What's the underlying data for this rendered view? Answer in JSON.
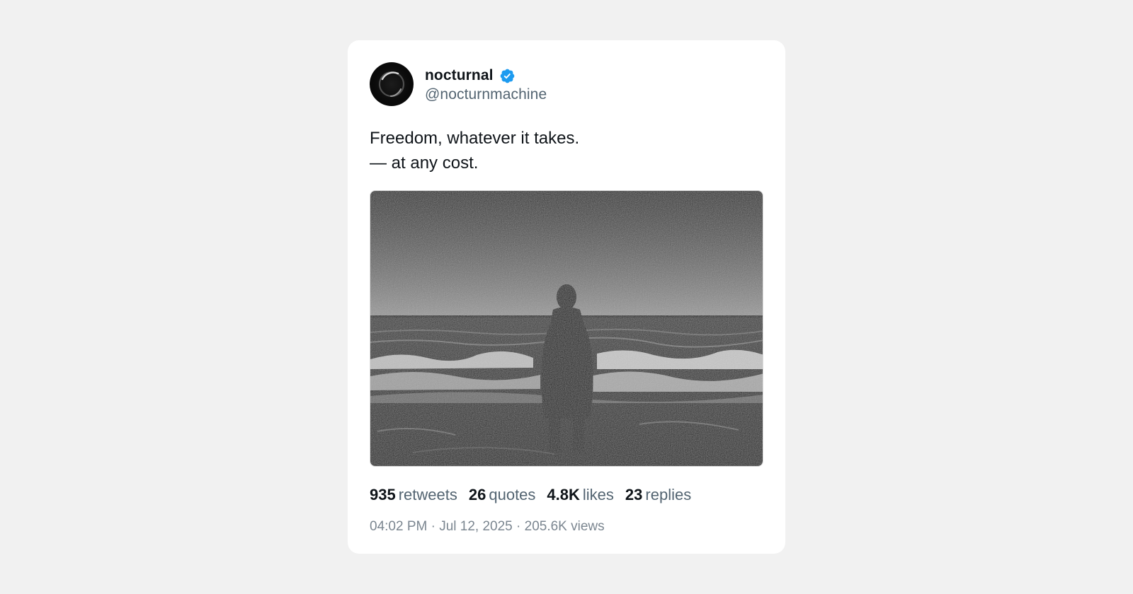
{
  "author": {
    "display_name": "nocturnal",
    "handle": "@nocturnmachine",
    "verified": true,
    "verified_badge_color": "#1d9bf0"
  },
  "tweet": {
    "lines": [
      "Freedom, whatever it takes.",
      "— at any cost."
    ]
  },
  "media": {
    "icon": "photo"
  },
  "stats": [
    {
      "value": "935",
      "label": "retweets"
    },
    {
      "value": "26",
      "label": "quotes"
    },
    {
      "value": "4.8K",
      "label": "likes"
    },
    {
      "value": "23",
      "label": "replies"
    }
  ],
  "meta": {
    "time": "04:02 PM",
    "separator": " · ",
    "date": "Jul 12, 2025",
    "views": "205.6K views"
  }
}
